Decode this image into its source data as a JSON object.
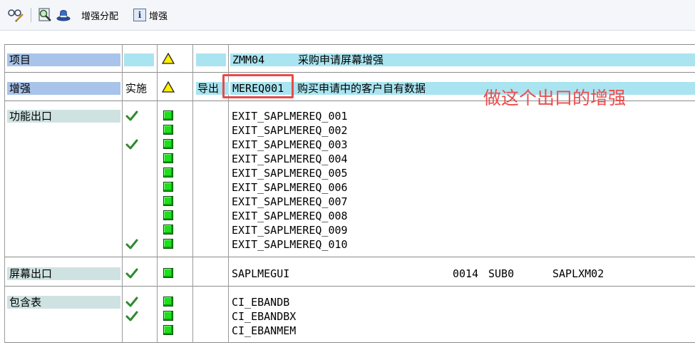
{
  "toolbar": {
    "enh_assign_label": "增强分配",
    "enh_label": "增强"
  },
  "rows": {
    "project": {
      "label": "项目",
      "value": "ZMM04",
      "desc": "采购申请屏幕增强"
    },
    "enhancement": {
      "label": "增强",
      "impl": "实施",
      "export": "导出",
      "value": "MEREQ001",
      "desc": "购买申请中的客户自有数据"
    },
    "function_exits": {
      "label": "功能出口",
      "items": [
        {
          "name": "EXIT_SAPLMEREQ_001",
          "checked": true
        },
        {
          "name": "EXIT_SAPLMEREQ_002",
          "checked": false
        },
        {
          "name": "EXIT_SAPLMEREQ_003",
          "checked": true
        },
        {
          "name": "EXIT_SAPLMEREQ_004",
          "checked": false
        },
        {
          "name": "EXIT_SAPLMEREQ_005",
          "checked": false
        },
        {
          "name": "EXIT_SAPLMEREQ_006",
          "checked": false
        },
        {
          "name": "EXIT_SAPLMEREQ_007",
          "checked": false
        },
        {
          "name": "EXIT_SAPLMEREQ_008",
          "checked": false
        },
        {
          "name": "EXIT_SAPLMEREQ_009",
          "checked": false
        },
        {
          "name": "EXIT_SAPLMEREQ_010",
          "checked": true
        }
      ]
    },
    "screen_exits": {
      "label": "屏幕出口",
      "program": "SAPLMEGUI",
      "screen": "0014",
      "area": "SUB0",
      "called_program": "SAPLXM02"
    },
    "includes": {
      "label": "包含表",
      "items": [
        {
          "name": "CI_EBANDB",
          "checked": true
        },
        {
          "name": "CI_EBANDBX",
          "checked": true
        },
        {
          "name": "CI_EBANMEM",
          "checked": false
        }
      ]
    }
  },
  "annotation": "做这个出口的增强",
  "colors": {
    "label_blue": "#a9c4ea",
    "label_teal": "#cfe2e2",
    "field_cyan": "#a9e4f0",
    "status_green": "#1ee01e",
    "warning_yellow": "#ffee00",
    "annotation_red": "#ef4b4b"
  }
}
